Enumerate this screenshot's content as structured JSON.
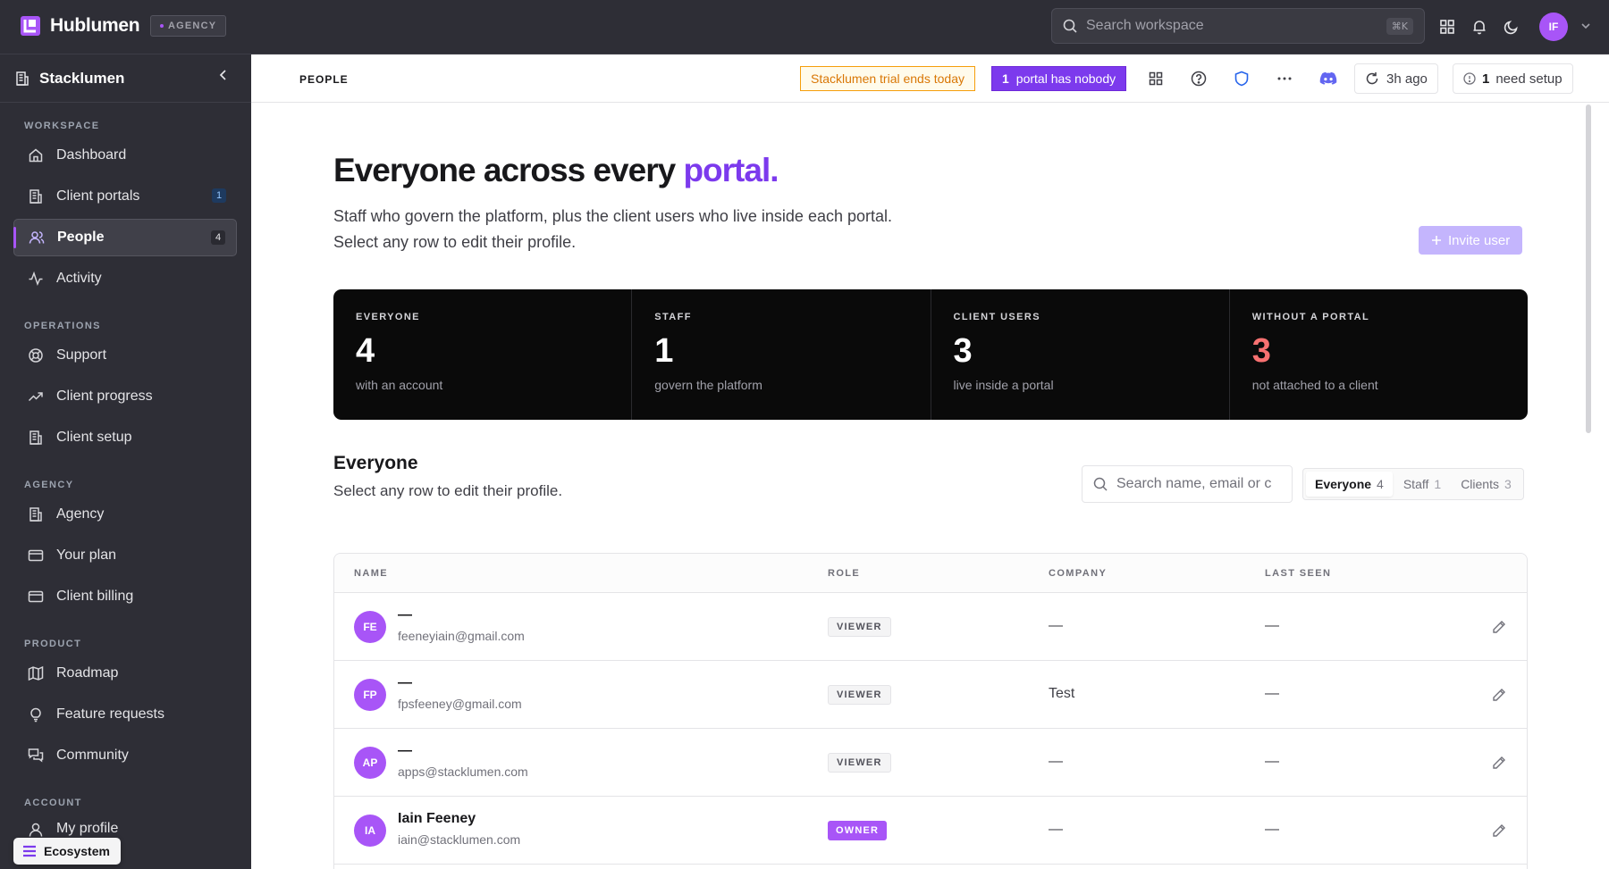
{
  "app": {
    "brand": "Hublumen",
    "badge": "AGENCY",
    "search_placeholder": "Search workspace",
    "search_shortcut": "⌘K",
    "user_initials": "IF"
  },
  "sidebar": {
    "workspace": "Stacklumen",
    "sections": [
      {
        "title": "WORKSPACE",
        "items": [
          {
            "label": "Dashboard",
            "icon": "home-icon"
          },
          {
            "label": "Client portals",
            "icon": "building-icon",
            "badge": "1"
          },
          {
            "label": "People",
            "icon": "users-icon",
            "badge": "4",
            "active": true
          },
          {
            "label": "Activity",
            "icon": "activity-icon"
          }
        ]
      },
      {
        "title": "OPERATIONS",
        "items": [
          {
            "label": "Support",
            "icon": "lifebuoy-icon"
          },
          {
            "label": "Client progress",
            "icon": "trending-up-icon"
          },
          {
            "label": "Client setup",
            "icon": "building-icon"
          }
        ]
      },
      {
        "title": "AGENCY",
        "items": [
          {
            "label": "Agency",
            "icon": "building-icon"
          },
          {
            "label": "Your plan",
            "icon": "credit-card-icon"
          },
          {
            "label": "Client billing",
            "icon": "credit-card-icon"
          }
        ]
      },
      {
        "title": "PRODUCT",
        "items": [
          {
            "label": "Roadmap",
            "icon": "map-icon"
          },
          {
            "label": "Feature requests",
            "icon": "lightbulb-icon"
          },
          {
            "label": "Community",
            "icon": "chat-icon"
          }
        ]
      },
      {
        "title": "ACCOUNT",
        "items": [
          {
            "label": "My profile",
            "icon": "user-icon"
          }
        ]
      }
    ],
    "ecosystem_label": "Ecosystem"
  },
  "subheader": {
    "breadcrumb": "PEOPLE",
    "trial": "Stacklumen trial ends today",
    "portal_count": "1",
    "portal_text": "portal has nobody",
    "refresh_label": "3h ago",
    "setup_count": "1",
    "setup_text": "need setup"
  },
  "page": {
    "headline_main": "Everyone across every",
    "headline_accent": "portal.",
    "subtitle_1": "Staff who govern the platform, plus the client users who live inside each portal.",
    "subtitle_2": "Select any row to edit their profile.",
    "invite_label": "Invite user",
    "accent_color": "#7c3aed"
  },
  "stats": [
    {
      "label": "EVERYONE",
      "value": "4",
      "desc": "with an account"
    },
    {
      "label": "STAFF",
      "value": "1",
      "desc": "govern the platform"
    },
    {
      "label": "CLIENT USERS",
      "value": "3",
      "desc": "live inside a portal"
    },
    {
      "label": "WITHOUT A PORTAL",
      "value": "3",
      "desc": "not attached to a client",
      "warn": true
    }
  ],
  "people": {
    "title": "Everyone",
    "subtitle": "Select any row to edit their profile.",
    "search_placeholder": "Search name, email or c",
    "filters": [
      {
        "label": "Everyone",
        "count": "4",
        "active": true
      },
      {
        "label": "Staff",
        "count": "1"
      },
      {
        "label": "Clients",
        "count": "3"
      }
    ],
    "columns": [
      "NAME",
      "ROLE",
      "COMPANY",
      "LAST SEEN"
    ],
    "rows": [
      {
        "initials": "FE",
        "name": "—",
        "email": "feeneyiain@gmail.com",
        "role": "VIEWER",
        "company": "—",
        "last_seen": "—"
      },
      {
        "initials": "FP",
        "name": "—",
        "email": "fpsfeeney@gmail.com",
        "role": "VIEWER",
        "company": "Test",
        "last_seen": "—"
      },
      {
        "initials": "AP",
        "name": "—",
        "email": "apps@stacklumen.com",
        "role": "VIEWER",
        "company": "—",
        "last_seen": "—"
      },
      {
        "initials": "IA",
        "name": "Iain Feeney",
        "email": "iain@stacklumen.com",
        "role": "OWNER",
        "company": "—",
        "last_seen": "—"
      }
    ]
  }
}
